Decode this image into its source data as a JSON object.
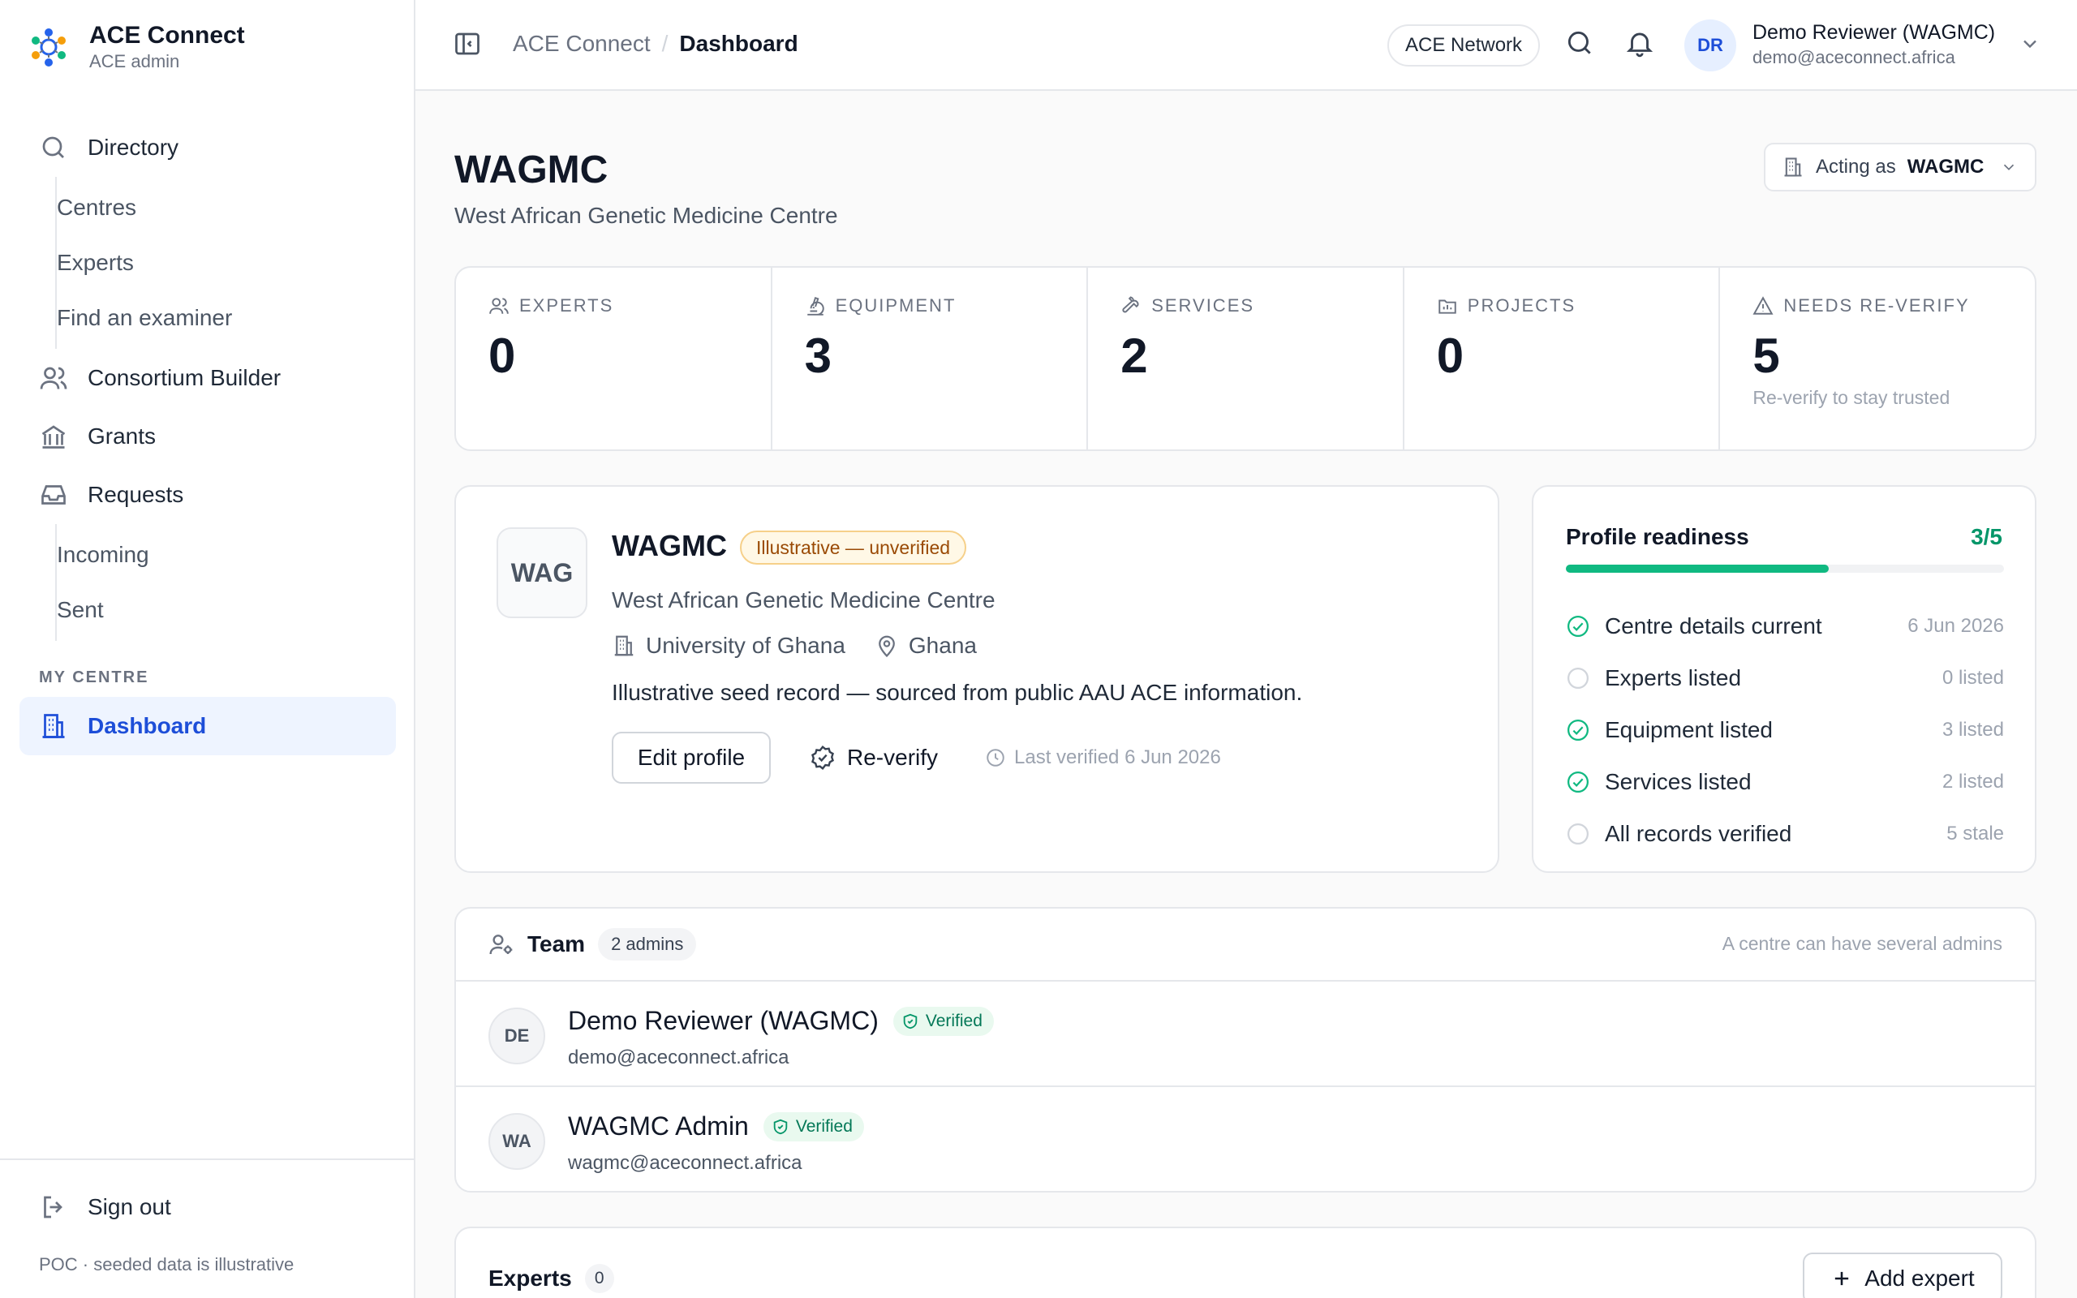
{
  "brand": {
    "title": "ACE Connect",
    "subtitle": "ACE admin"
  },
  "sidebar": {
    "directory": "Directory",
    "directory_items": [
      "Centres",
      "Experts",
      "Find an examiner"
    ],
    "consortium": "Consortium Builder",
    "grants": "Grants",
    "requests": "Requests",
    "requests_items": [
      "Incoming",
      "Sent"
    ],
    "section_label": "MY CENTRE",
    "dashboard": "Dashboard",
    "sign_out": "Sign out",
    "footer_note": "POC · seeded data is illustrative"
  },
  "topbar": {
    "breadcrumb_root": "ACE Connect",
    "breadcrumb_sep": "/",
    "breadcrumb_current": "Dashboard",
    "network": "ACE Network",
    "avatar_initials": "DR",
    "user_name": "Demo Reviewer (WAGMC)",
    "user_email": "demo@aceconnect.africa"
  },
  "page": {
    "title": "WAGMC",
    "subtitle": "West African Genetic Medicine Centre",
    "acting_label": "Acting as",
    "acting_value": "WAGMC"
  },
  "stats": [
    {
      "label": "EXPERTS",
      "value": "0",
      "note": ""
    },
    {
      "label": "EQUIPMENT",
      "value": "3",
      "note": ""
    },
    {
      "label": "SERVICES",
      "value": "2",
      "note": ""
    },
    {
      "label": "PROJECTS",
      "value": "0",
      "note": ""
    },
    {
      "label": "NEEDS RE-VERIFY",
      "value": "5",
      "note": "Re-verify to stay trusted"
    }
  ],
  "profile": {
    "logo_text": "WAG",
    "name": "WAGMC",
    "badge": "Illustrative — unverified",
    "full_name": "West African Genetic Medicine Centre",
    "university": "University of Ghana",
    "country": "Ghana",
    "description": "Illustrative seed record — sourced from public AAU ACE information.",
    "edit_label": "Edit profile",
    "reverify_label": "Re-verify",
    "last_verified": "Last verified 6 Jun 2026"
  },
  "readiness": {
    "title": "Profile readiness",
    "score": "3/5",
    "progress": 0.6,
    "items": [
      {
        "label": "Centre details current",
        "value": "6 Jun 2026",
        "done": true
      },
      {
        "label": "Experts listed",
        "value": "0 listed",
        "done": false
      },
      {
        "label": "Equipment listed",
        "value": "3 listed",
        "done": true
      },
      {
        "label": "Services listed",
        "value": "2 listed",
        "done": true
      },
      {
        "label": "All records verified",
        "value": "5 stale",
        "done": false
      }
    ],
    "color_done": "#10b981",
    "color_todo": "#d1d5db"
  },
  "team": {
    "title": "Team",
    "count": "2 admins",
    "note": "A centre can have several admins",
    "members": [
      {
        "initials": "DE",
        "name": "Demo Reviewer (WAGMC)",
        "badge": "Verified",
        "email": "demo@aceconnect.africa"
      },
      {
        "initials": "WA",
        "name": "WAGMC Admin",
        "badge": "Verified",
        "email": "wagmc@aceconnect.africa"
      }
    ]
  },
  "experts": {
    "title": "Experts",
    "count": "0",
    "add_label": "Add expert"
  }
}
